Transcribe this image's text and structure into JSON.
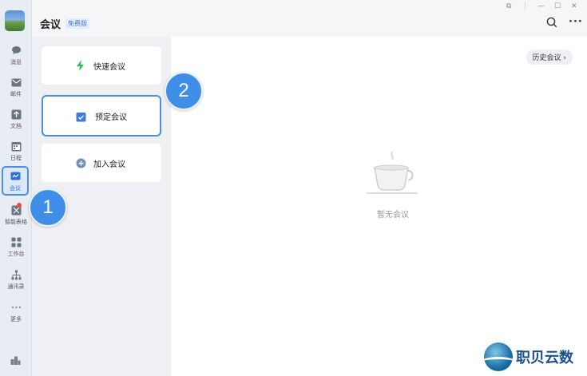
{
  "header": {
    "title": "会议",
    "plan_badge": "免费版"
  },
  "window": {
    "restore_glyph": "⧉",
    "minimize_glyph": "—",
    "maximize_glyph": "☐",
    "close_glyph": "✕"
  },
  "sidebar": {
    "items": [
      {
        "label": "消息",
        "icon": "chat-icon"
      },
      {
        "label": "邮件",
        "icon": "mail-icon"
      },
      {
        "label": "文档",
        "icon": "doc-icon"
      },
      {
        "label": "日程",
        "icon": "calendar-icon"
      },
      {
        "label": "会议",
        "icon": "meeting-icon",
        "active": true
      },
      {
        "label": "智能表格",
        "icon": "smart-sheet-icon",
        "has_badge": true
      },
      {
        "label": "工作台",
        "icon": "workbench-icon"
      },
      {
        "label": "通讯录",
        "icon": "contacts-icon"
      },
      {
        "label": "更多",
        "icon": "more-dots-icon"
      }
    ]
  },
  "meeting_actions": [
    {
      "label": "快速会议",
      "icon": "lightning-icon"
    },
    {
      "label": "预定会议",
      "icon": "calendar-check-icon",
      "selected": true
    },
    {
      "label": "加入会议",
      "icon": "plus-circle-icon"
    }
  ],
  "main": {
    "history_button": "历史会议 ›",
    "empty_text": "暂无会议"
  },
  "annotations": {
    "step1": "1",
    "step2": "2"
  },
  "watermark": {
    "text": "职贝云数"
  },
  "colors": {
    "accent": "#4a90e2",
    "badge": "#f04a3e",
    "quick_green": "#2fc05a"
  }
}
